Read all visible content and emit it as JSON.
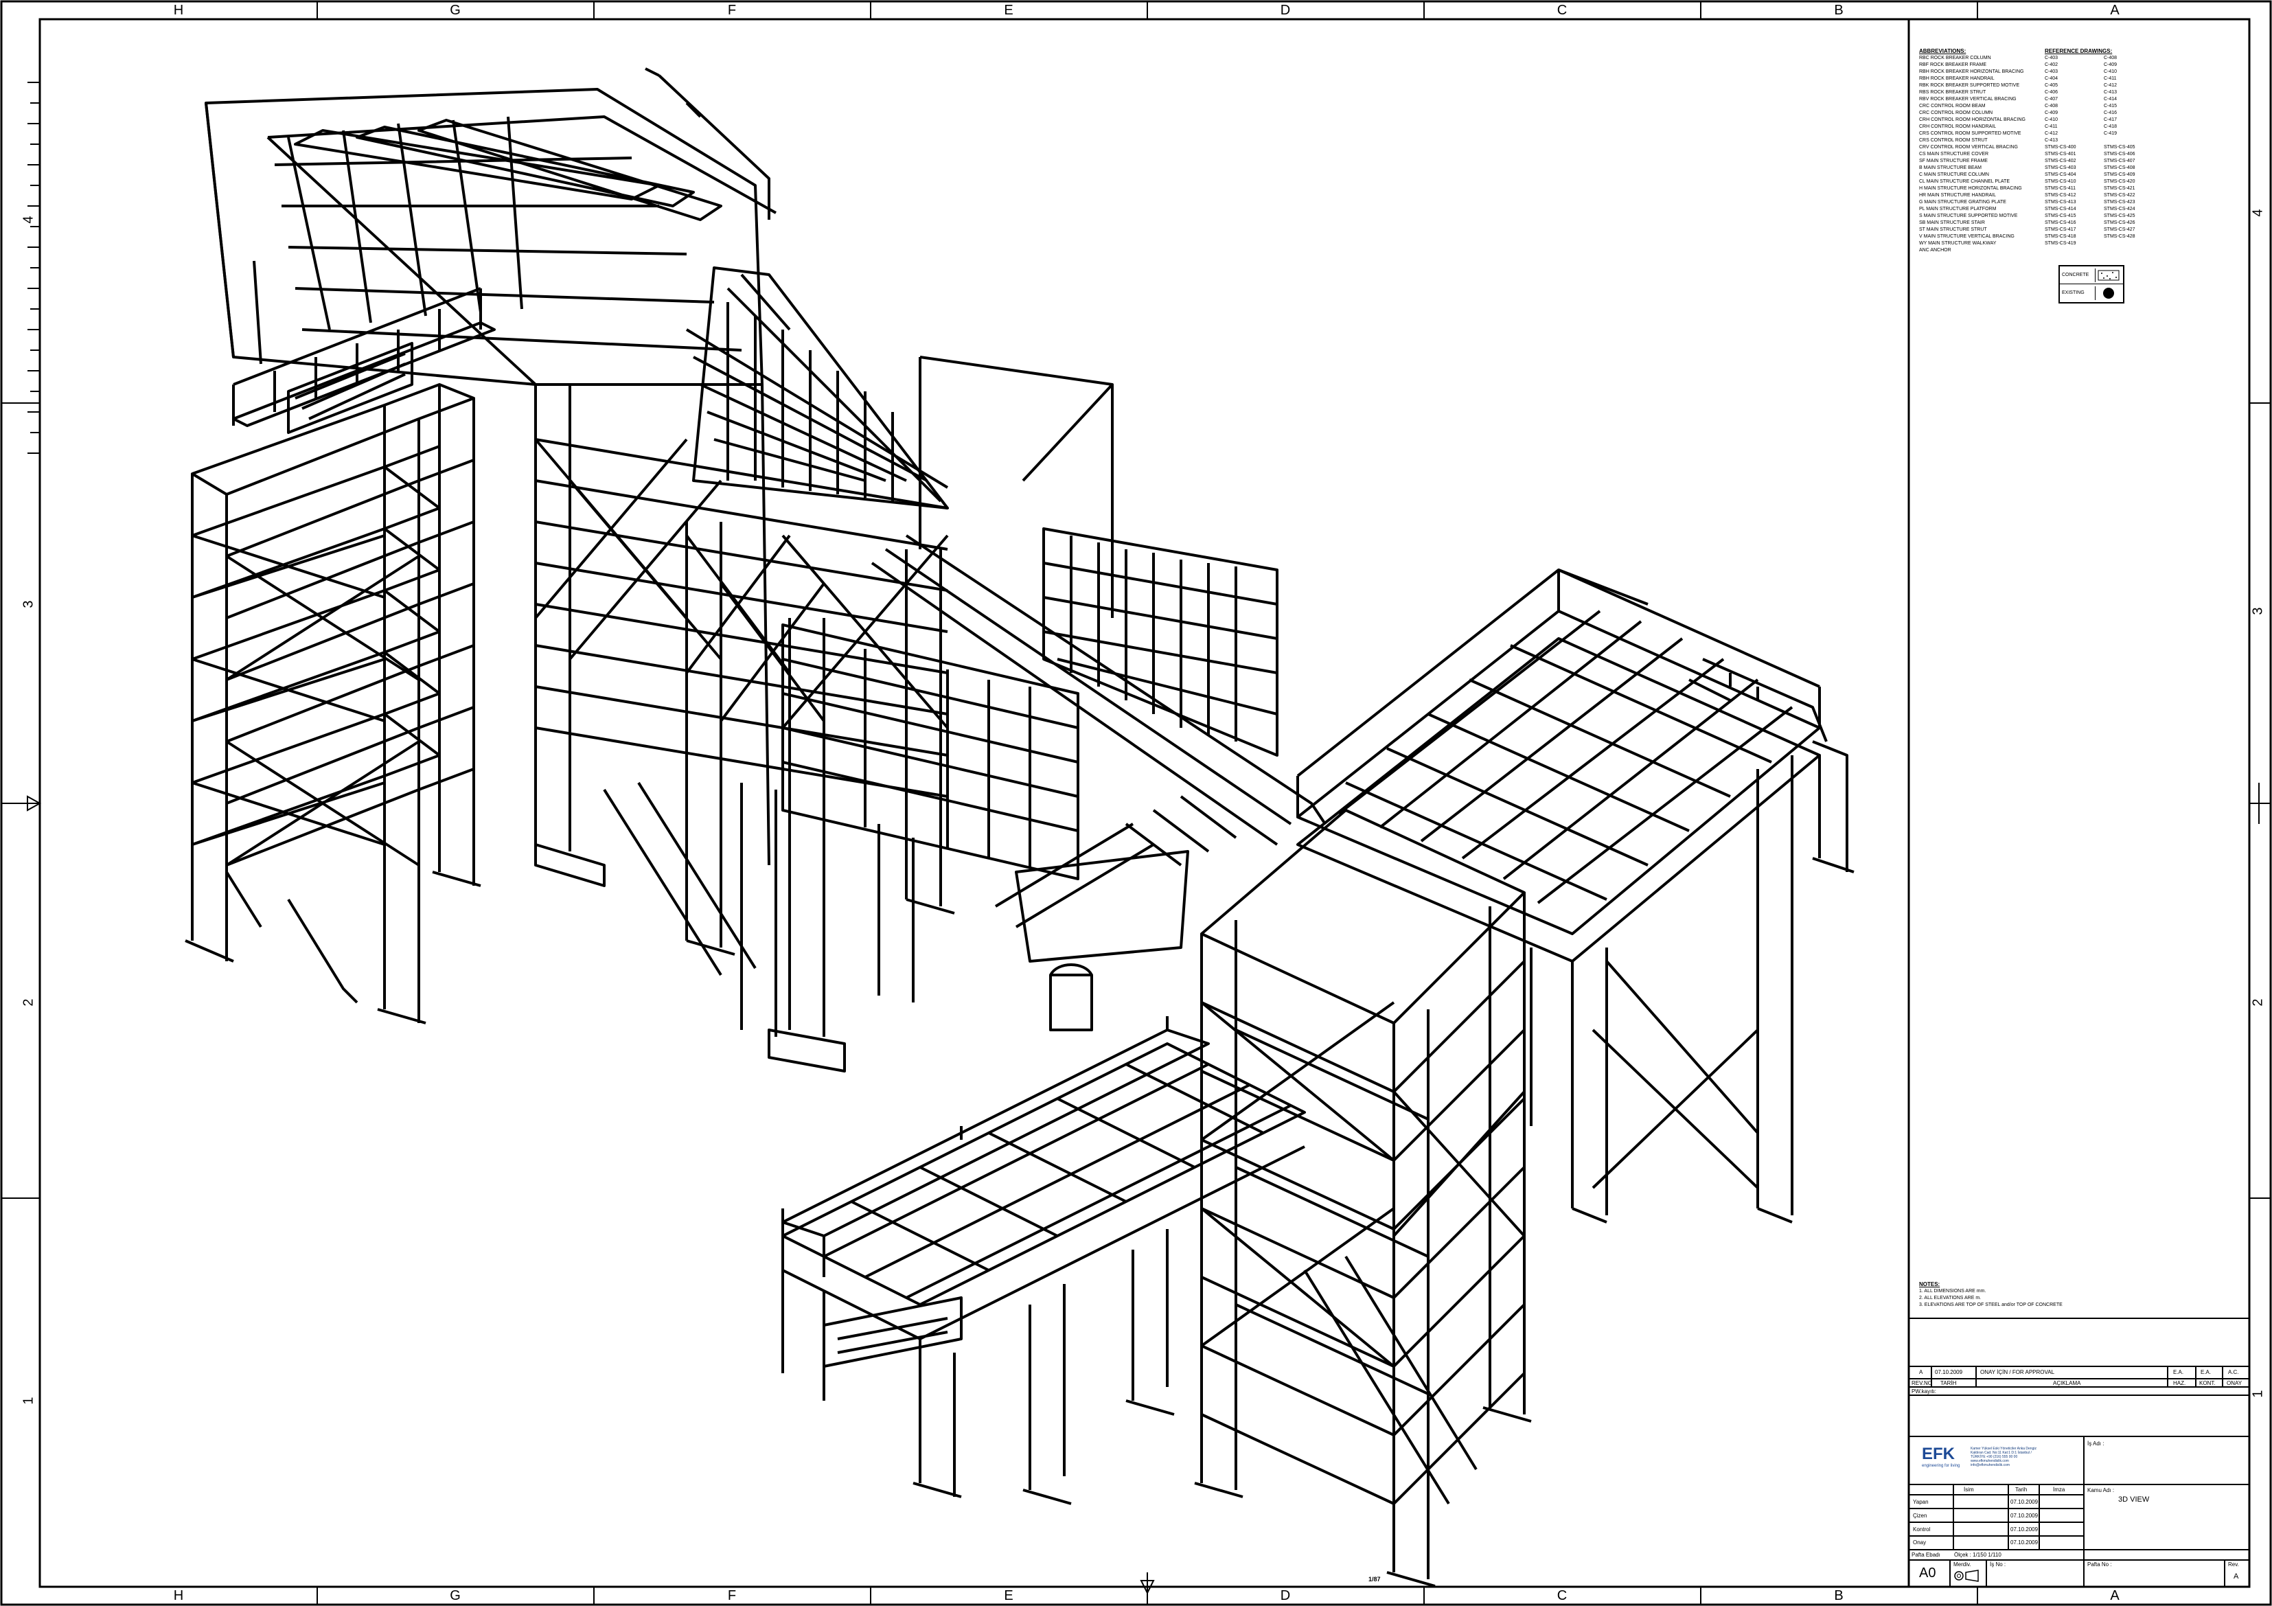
{
  "border": {
    "columns_top": [
      "H",
      "G",
      "F",
      "E",
      "D",
      "C",
      "B",
      "A"
    ],
    "columns_bottom": [
      "H",
      "G",
      "F",
      "E",
      "D",
      "C",
      "B",
      "A"
    ],
    "rows_left": [
      "4",
      "3",
      "2",
      "1"
    ],
    "rows_right": [
      "4",
      "3",
      "2",
      "1"
    ]
  },
  "legend": {
    "heading": "ABBREVIATIONS:",
    "items": [
      "RBC ROCK BREAKER COLUMN",
      "RBF ROCK BREAKER FRAME",
      "RBH ROCK BREAKER HORIZONTAL BRACING",
      "RBH ROCK BREAKER HANDRAIL",
      "RBK ROCK BREAKER SUPPORTED MOTIVE",
      "RBS ROCK BREAKER STRUT",
      "RBV ROCK BREAKER VERTICAL BRACING",
      "CRC CONTROL ROOM BEAM",
      "CRC CONTROL ROOM COLUMN",
      "CRH CONTROL ROOM HORIZONTAL BRACING",
      "CRH CONTROL ROOM HANDRAIL",
      "CRS CONTROL ROOM SUPPORTED MOTIVE",
      "CRS CONTROL ROOM STRUT",
      "CRV CONTROL ROOM VERTICAL BRACING",
      "CS MAIN STRUCTURE COVER",
      "SF MAIN STRUCTURE FRAME",
      "B MAIN STRUCTURE BEAM",
      "C MAIN STRUCTURE COLUMN",
      "CL MAIN STRUCTURE CHANNEL PLATE",
      "H MAIN STRUCTURE HORIZONTAL BRACING",
      "HR MAIN STRUCTURE HANDRAIL",
      "G MAIN STRUCTURE GRATING PLATE",
      "PL MAIN STRUCTURE PLATFORM",
      "S MAIN STRUCTURE SUPPORTED MOTIVE",
      "SB MAIN STRUCTURE STAIR",
      "ST MAIN STRUCTURE STRUT",
      "V MAIN STRUCTURE VERTICAL BRACING",
      "WY MAIN STRUCTURE WALKWAY",
      "ANC ANCHOR"
    ]
  },
  "references": {
    "heading": "REFERENCE DRAWINGS:",
    "rows": [
      [
        "C-403",
        "C-408"
      ],
      [
        "C-402",
        "C-409"
      ],
      [
        "C-403",
        "C-410"
      ],
      [
        "C-404",
        "C-411"
      ],
      [
        "C-405",
        "C-412"
      ],
      [
        "C-406",
        "C-413"
      ],
      [
        "C-407",
        "C-414"
      ],
      [
        "C-408",
        "C-415"
      ],
      [
        "C-409",
        "C-416"
      ],
      [
        "C-410",
        "C-417"
      ],
      [
        "C-411",
        "C-418"
      ],
      [
        "C-412",
        "C-419"
      ],
      [
        "C-413",
        ""
      ],
      [
        "STMS-CS-400",
        "STMS-CS-405"
      ],
      [
        "STMS-CS-401",
        "STMS-CS-406"
      ],
      [
        "STMS-CS-402",
        "STMS-CS-407"
      ],
      [
        "STMS-CS-403",
        "STMS-CS-408"
      ],
      [
        "STMS-CS-404",
        "STMS-CS-409"
      ],
      [
        "STMS-CS-410",
        "STMS-CS-420"
      ],
      [
        "STMS-CS-411",
        "STMS-CS-421"
      ],
      [
        "STMS-CS-412",
        "STMS-CS-422"
      ],
      [
        "STMS-CS-413",
        "STMS-CS-423"
      ],
      [
        "STMS-CS-414",
        "STMS-CS-424"
      ],
      [
        "STMS-CS-415",
        "STMS-CS-425"
      ],
      [
        "STMS-CS-416",
        "STMS-CS-426"
      ],
      [
        "STMS-CS-417",
        "STMS-CS-427"
      ],
      [
        "STMS-CS-418",
        "STMS-CS-428"
      ],
      [
        "STMS-CS-419",
        ""
      ]
    ]
  },
  "material_key": {
    "concrete": "CONCRETE",
    "existing": "EXISTING"
  },
  "notes": {
    "heading": "NOTES:",
    "items": [
      "1. ALL DIMENSIONS ARE mm.",
      "2. ALL ELEVATIONS ARE m.",
      "3. ELEVATIONS ARE TOP OF STEEL and/or TOP OF CONCRETE"
    ]
  },
  "revision": {
    "rev": "A",
    "date": "07.10.2009",
    "description": "ONAY İÇİN / FOR APPROVAL",
    "haz": "E.A.",
    "kont": "E.A.",
    "onay": "A.C.",
    "header_rev": "REV.NO",
    "header_date": "TARİH",
    "header_desc": "AÇIKLAMA",
    "header_haz": "HAZ.",
    "header_kont": "KONT.",
    "header_onay": "ONAY",
    "ps": "PW.kayıtı:"
  },
  "company": {
    "logo": "EFK",
    "tagline": "engineering for living",
    "info": "Kamer Yüksel Eski Yöneticiler Anka Dengiz Kaldıran Cad. No:11 Kat:1 D:1 İstanbul / TÜRKİYE +90 (216) 555 00 00 www.efkmuhendislik.com info@efkmuhendislik.com"
  },
  "signoff": {
    "header_isim": "İsim",
    "header_tarih": "Tarih",
    "header_imza": "İmza",
    "rows": [
      {
        "role": "Yapan",
        "date": "07.10.2009"
      },
      {
        "role": "Çizen",
        "date": "07.10.2009"
      },
      {
        "role": "Kontrol",
        "date": "07.10.2009"
      },
      {
        "role": "Onay",
        "date": "07.10.2009"
      }
    ]
  },
  "titleblock": {
    "is_adi_label": "İş Adı :",
    "kamu_label": "Kamu Adı :",
    "drawing_title": "3D VIEW",
    "paftalar_label": "Pafta Ebadı",
    "olcek_label": "Ölçek : 1/150 1/110",
    "size": "A0",
    "pafta_no_label": "Pafta No :",
    "rev_label": "Rev.",
    "rev_value": "A",
    "is_no_label": "İş No :",
    "merdiven_label": "Merdiv."
  },
  "scale_mark": "1/87"
}
